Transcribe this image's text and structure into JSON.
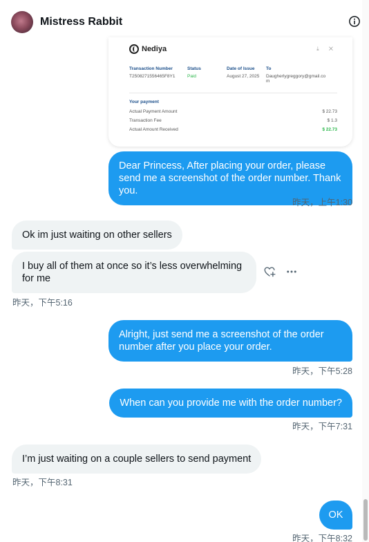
{
  "header": {
    "name": "Mistress Rabbit"
  },
  "receipt": {
    "brand": "Nediya",
    "tools": "⤓ ✕",
    "columns": [
      "Transaction Number",
      "Status",
      "Date of Issue",
      "To"
    ],
    "values": [
      "T2508271556465F8Y1",
      "Paid",
      "August 27, 2025",
      "Daugherlygreggory@gmail.com"
    ],
    "payment_title": "Your payment",
    "payments": [
      {
        "label": "Actual Payment Amount",
        "value": "$ 22.73"
      },
      {
        "label": "Transaction Fee",
        "value": "$ 1.3"
      },
      {
        "label": "Actual Amount Received",
        "value": "$ 22.73"
      }
    ]
  },
  "messages": [
    {
      "text": "Dear Princess, After placing your order, please send me a screenshot of the order number. Thank you.",
      "time": "昨天，上午1:30"
    },
    {
      "text": "Ok im just waiting on other sellers"
    },
    {
      "text": "I buy all of them at once so it’s less overwhelming for me",
      "time": "昨天，下午5:16"
    },
    {
      "text": "Alright, just send me a screenshot of the order number after you place your order.",
      "time": "昨天，下午5:28"
    },
    {
      "text": "When can you provide me with the order number?",
      "time": "昨天，下午7:31"
    },
    {
      "text": "I’m just waiting on a couple sellers to send payment",
      "time": "昨天，下午8:31"
    },
    {
      "text": "OK",
      "time": "昨天，下午8:32"
    }
  ],
  "actions": {
    "react": "add-reaction-icon",
    "more": "more-icon"
  },
  "colors": {
    "outgoing": "#1d9bf0",
    "incoming": "#eff3f4",
    "timestamp": "#536471",
    "paid": "#2ab74a"
  }
}
